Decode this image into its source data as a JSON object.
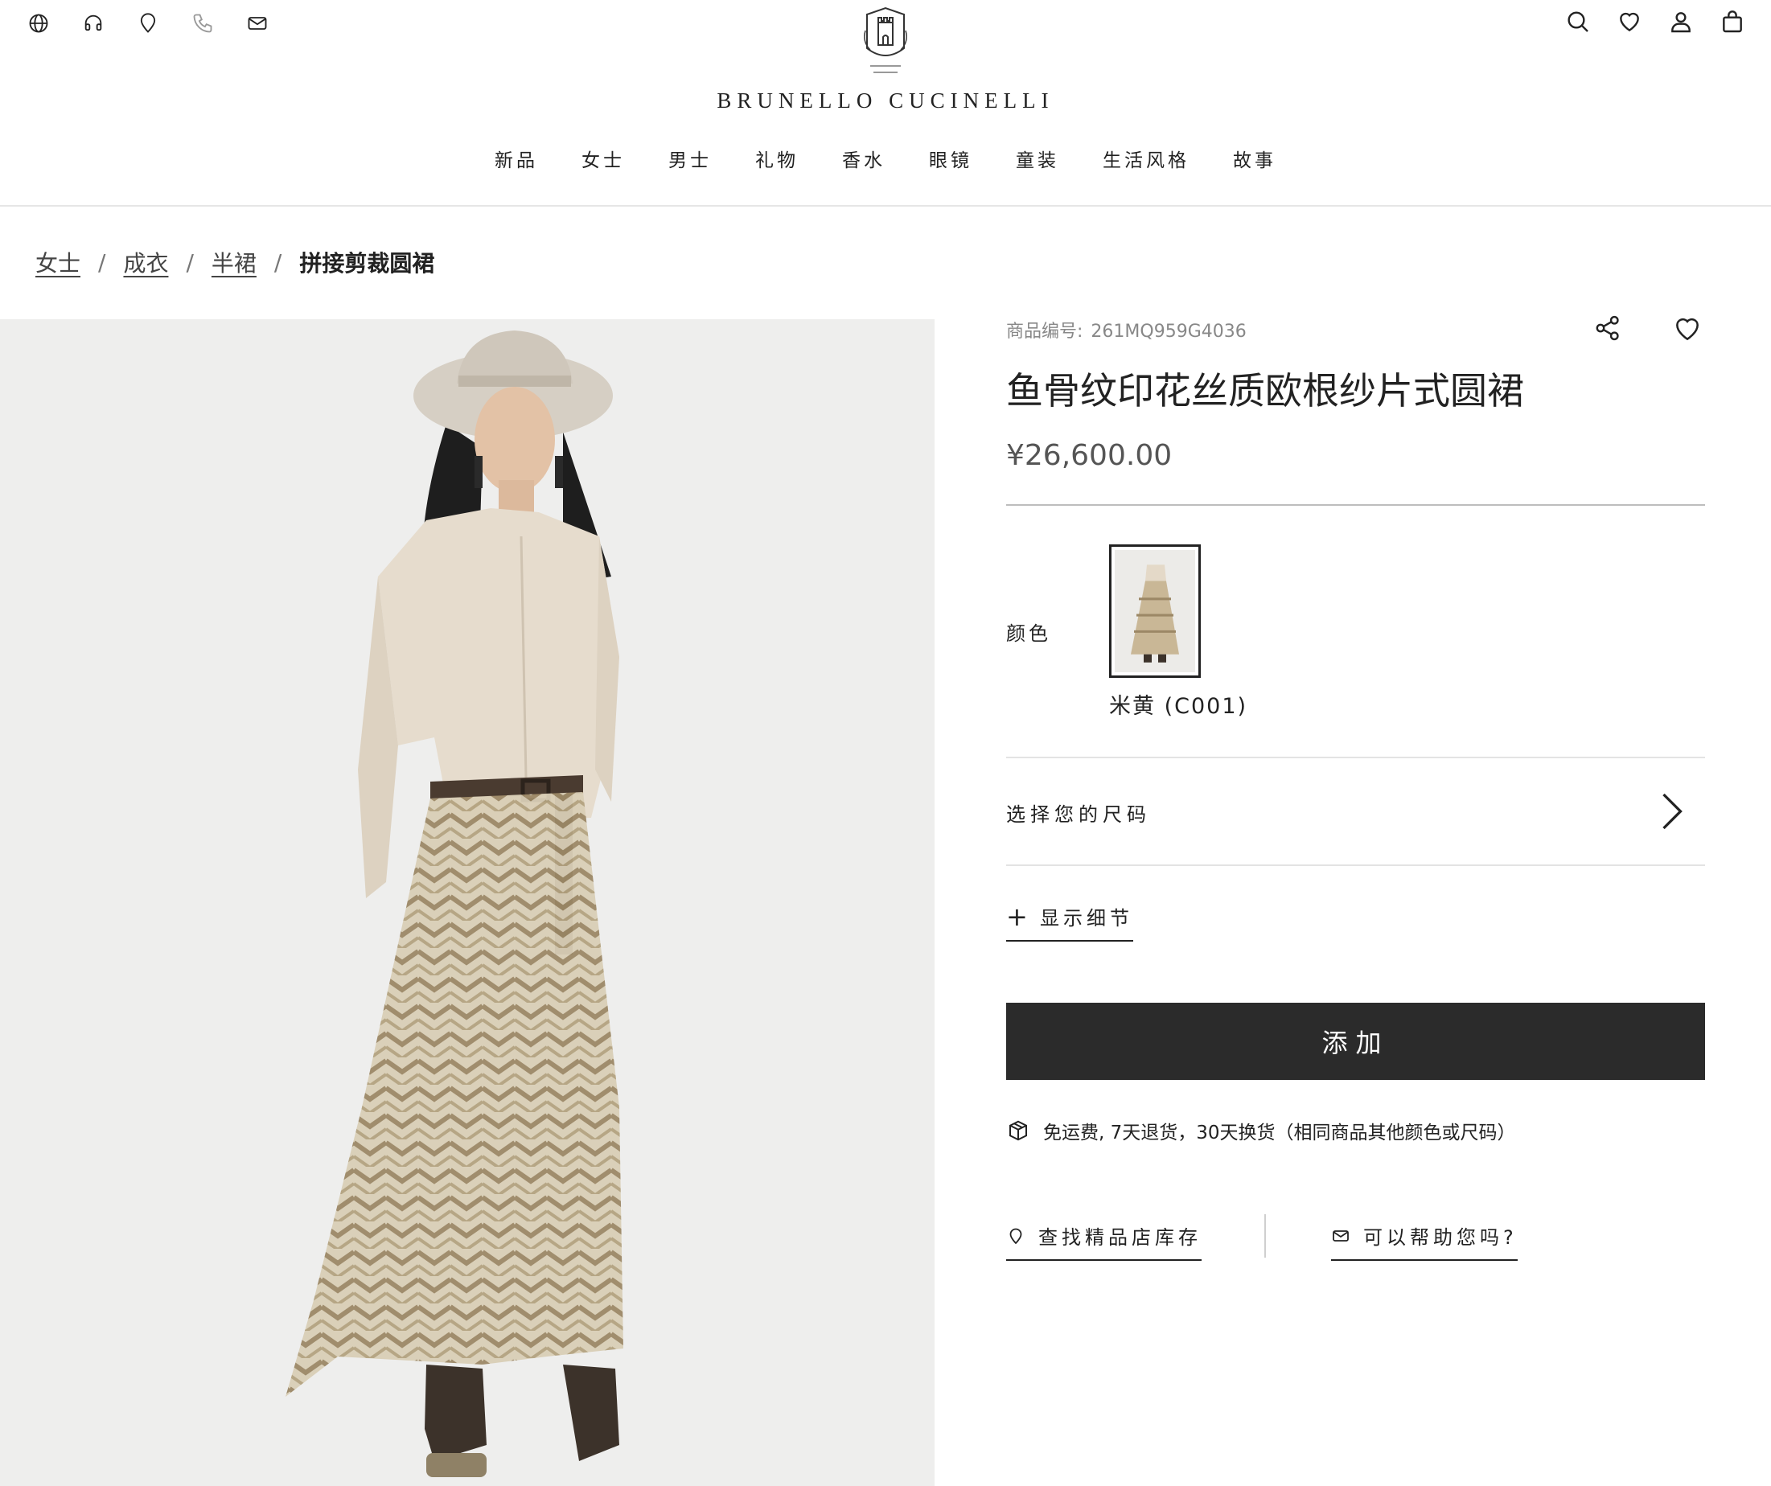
{
  "header": {
    "brand": "BRUNELLO CUCINELLI",
    "utility_left": [
      "globe-icon",
      "headset-icon",
      "location-icon",
      "phone-icon",
      "mail-icon"
    ],
    "utility_right": [
      "search-icon",
      "heart-icon",
      "user-icon",
      "bag-icon"
    ],
    "nav": [
      "新品",
      "女士",
      "男士",
      "礼物",
      "香水",
      "眼镜",
      "童装",
      "生活风格",
      "故事"
    ]
  },
  "breadcrumb": {
    "items": [
      "女士",
      "成衣",
      "半裙"
    ],
    "separator": "/",
    "current": "拼接剪裁圆裙"
  },
  "product": {
    "sku_label": "商品编号:",
    "sku": "261MQ959G4036",
    "title": "鱼骨纹印花丝质欧根纱片式圆裙",
    "price": "¥26,600.00",
    "color_label": "颜色",
    "color_selected": "米黄 (C001)",
    "size_label": "选择您的尺码",
    "details_label": "显示细节",
    "add_button": "添加",
    "shipping_note": "免运费, 7天退货，30天换货（相同商品其他颜色或尺码）",
    "store_link": "查找精品店库存",
    "help_link": "可以帮助您吗?"
  },
  "colors": {
    "button_bg": "#2b2b2b",
    "image_bg": "#eeeeed",
    "text": "#222222",
    "muted": "#888888"
  }
}
